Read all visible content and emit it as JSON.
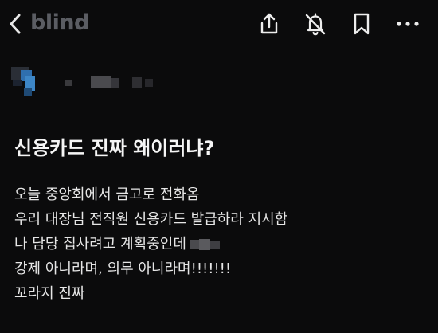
{
  "header": {
    "brand": "blind",
    "back_icon": "chevron-left-icon",
    "actions": [
      "share-icon",
      "notifications-off-icon",
      "bookmark-icon",
      "more-icon"
    ]
  },
  "post": {
    "title": "신용카드 진짜 왜이러냐?",
    "lines": [
      "오늘 중앙회에서 금고로 전화옴",
      "우리 대장님 전직원 신용카드 발급하라 지시함",
      "나 담당 집사려고 계획중인데",
      "강제 아니라며, 의무 아니라며!!!!!!!",
      "꼬라지 진짜"
    ]
  },
  "colors": {
    "background": "#0b0b0c",
    "text": "#e6e6e6",
    "brand": "#5b5d63",
    "avatar_blue": "#2f6fae"
  }
}
